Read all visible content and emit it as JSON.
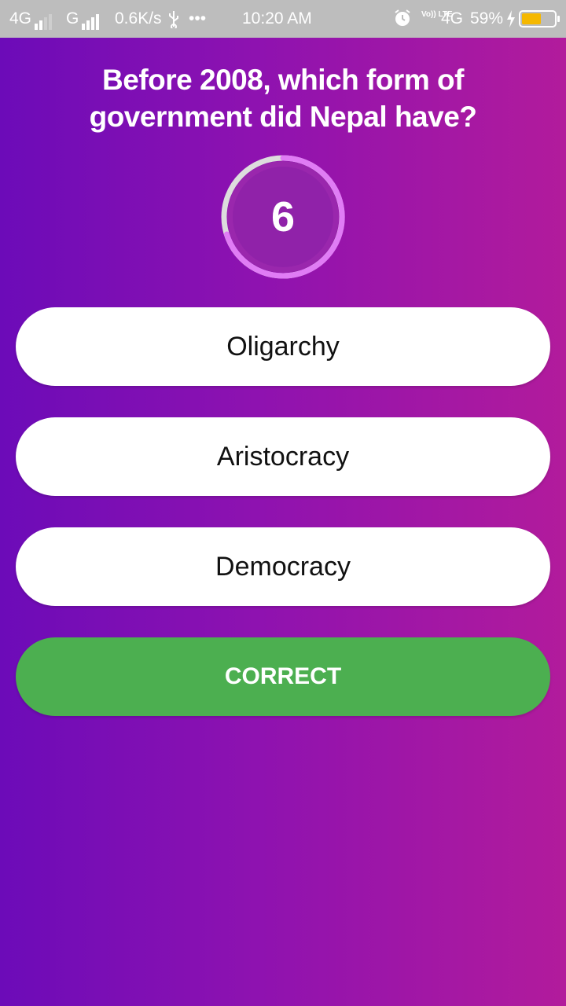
{
  "status_bar": {
    "network1": "4G",
    "network2": "G",
    "speed": "0.6K/s",
    "dots": "•••",
    "time": "10:20 AM",
    "volte": "Vo)) LTE",
    "network3": "4G",
    "battery_percent": "59%",
    "battery_level": 0.59
  },
  "quiz": {
    "question": "Before 2008, which form of government did Nepal have?",
    "timer_value": "6",
    "options": [
      {
        "label": "Oligarchy"
      },
      {
        "label": "Aristocracy"
      },
      {
        "label": "Democracy"
      }
    ],
    "correct_label": "CORRECT"
  },
  "colors": {
    "background_start": "#6c0bb8",
    "background_end": "#b21b9c",
    "timer_ring": "#e07cf5",
    "timer_track": "#dddddd",
    "timer_inner": "#9a27ad",
    "correct_button": "#4caf50"
  }
}
